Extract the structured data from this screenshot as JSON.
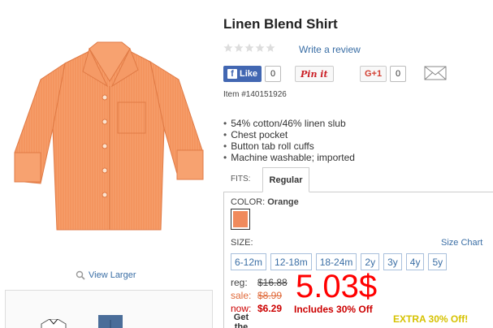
{
  "product": {
    "title": "Linen Blend Shirt",
    "write_review": "Write a review",
    "item_number": "Item #140151926",
    "features": [
      "54% cotton/46% linen slub",
      "Chest pocket",
      "Button tab roll cuffs",
      "Machine washable; imported"
    ],
    "rating_stars": 5,
    "rating_filled": 0
  },
  "social": {
    "like_label": "Like",
    "like_count": "0",
    "pinit_label": "Pin it",
    "gplus_label": "G+1",
    "gplus_count": "0"
  },
  "gallery": {
    "view_larger": "View Larger",
    "get_the_look": "Get the Look!"
  },
  "fits": {
    "label": "FITS:",
    "selected_tab": "Regular"
  },
  "color": {
    "label": "COLOR:",
    "value": "Orange",
    "swatch_hex": "#f08a5c"
  },
  "size": {
    "label": "SIZE:",
    "chart_link": "Size Chart",
    "options": [
      "6-12m",
      "12-18m",
      "18-24m",
      "2y",
      "3y",
      "4y",
      "5y"
    ]
  },
  "pricing": {
    "reg_label": "reg:",
    "reg_value": "$16.88",
    "sale_label": "sale:",
    "sale_value": "$8.99",
    "now_label": "now:",
    "now_value": "$6.29",
    "big_price": "5.03$",
    "includes_note": "Includes 30% Off",
    "extra_off": "EXTRA 30% Off!"
  },
  "colors": {
    "link": "#3a6ea5",
    "price_red": "#ff0000",
    "facebook": "#4267b2"
  }
}
